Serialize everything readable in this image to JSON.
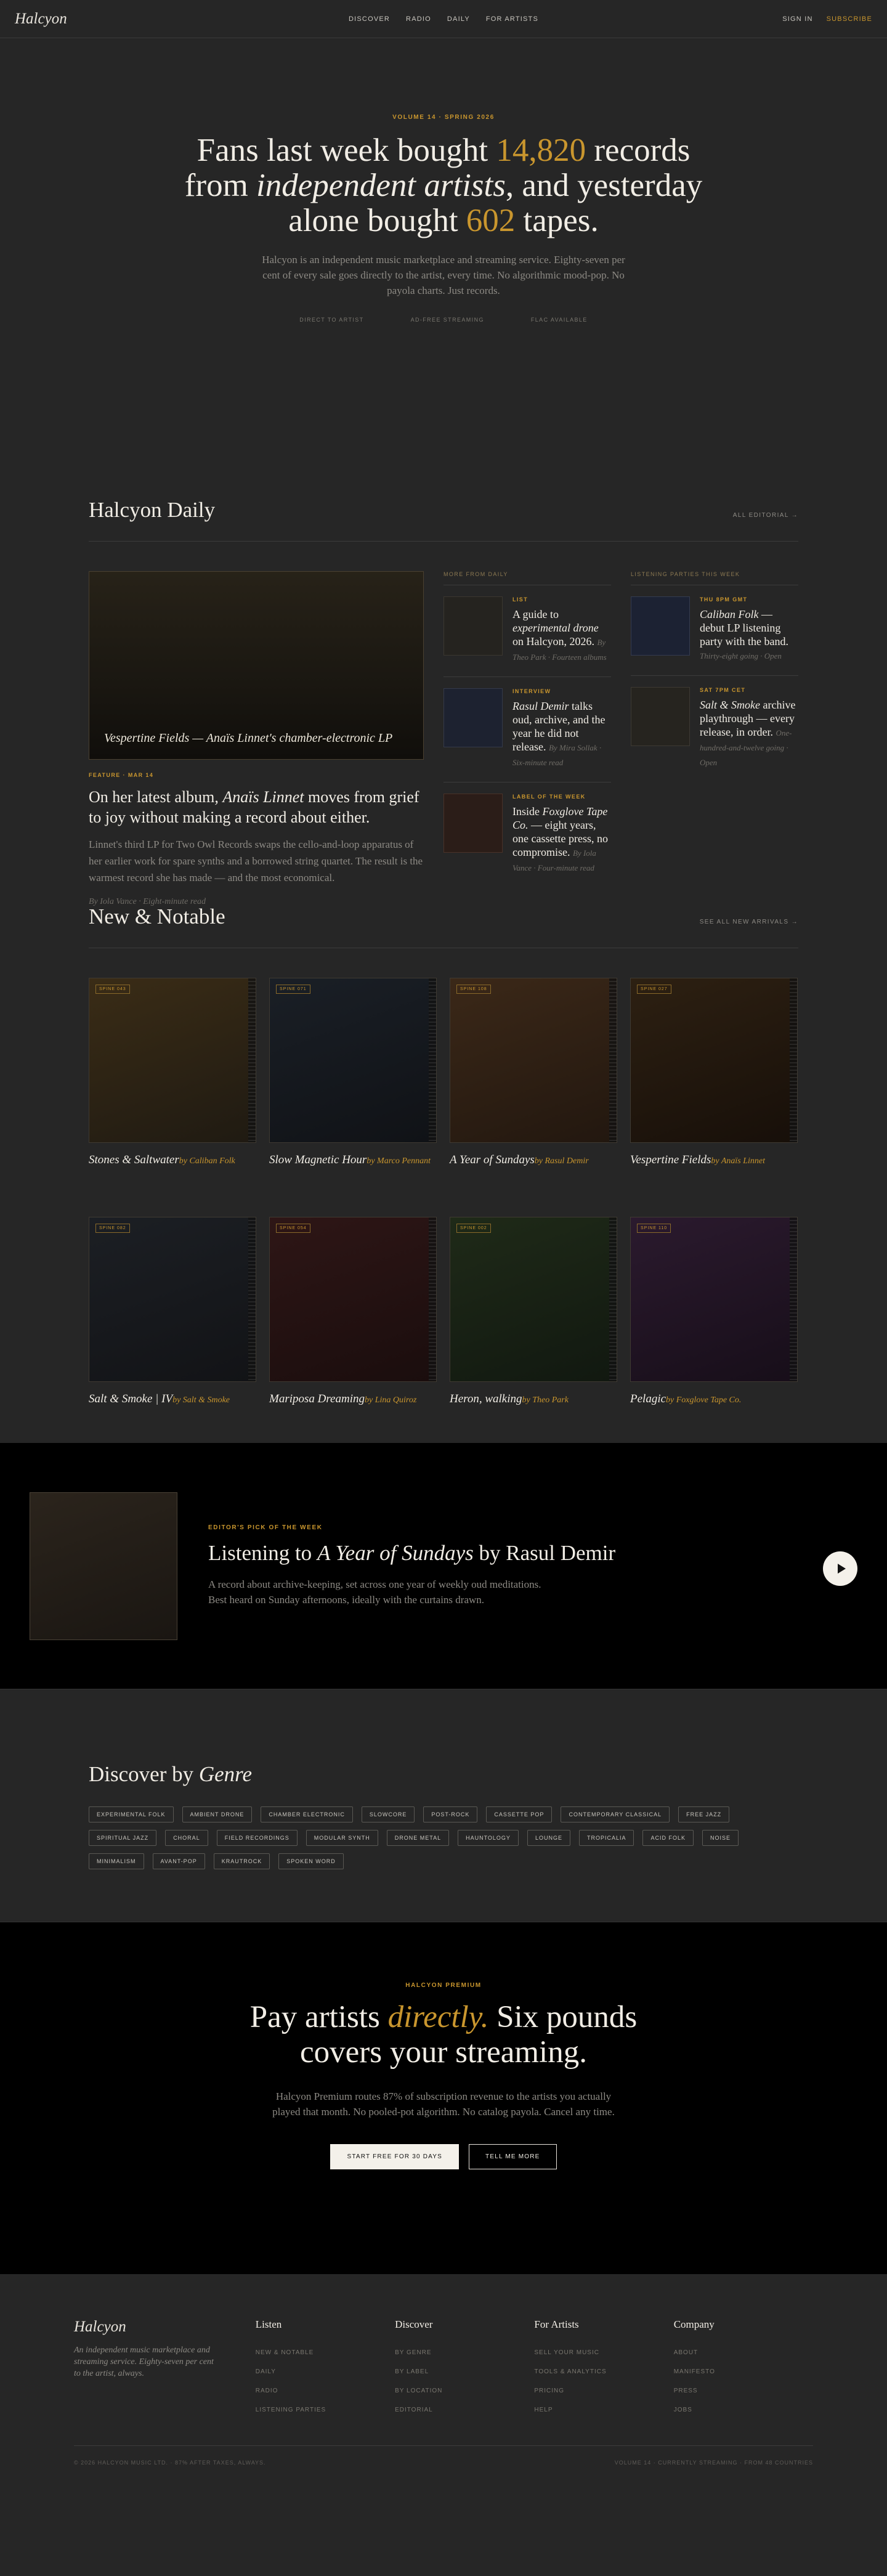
{
  "nav": {
    "logo": "Halcyon",
    "links": [
      "DISCOVER",
      "RADIO",
      "DAILY",
      "FOR ARTISTS"
    ],
    "sign_in": "SIGN IN",
    "subscribe": "SUBSCRIBE"
  },
  "hero": {
    "eyebrow": "VOLUME 14 · SPRING 2026",
    "line1a": "Fans last week bought ",
    "records_count": "14,820",
    "line1b": " records",
    "line2a": "from ",
    "line2em": "independent artists",
    "line2b": ", and yesterday",
    "line3a": "alone bought ",
    "tapes_count": "602",
    "line3b": " tapes.",
    "lead": "Halcyon is an independent music marketplace and streaming service. Eighty-seven per cent of every sale goes directly to the artist, every time. No algorithmic mood-pop. No payola charts. Just records.",
    "meta": [
      "DIRECT TO ARTIST",
      "AD-FREE STREAMING",
      "FLAC AVAILABLE"
    ]
  },
  "daily": {
    "title": "Halcyon Daily",
    "link": "ALL EDITORIAL →",
    "feature": {
      "caption": "Vespertine Fields — Anaïs Linnet's chamber-electronic LP",
      "kicker": "FEATURE · MAR 14",
      "h_a": "On her latest album, ",
      "h_em": "Anaïs Linnet",
      "h_b": " moves from grief to joy without making a record about either.",
      "body": "Linnet's third LP for Two Owl Records swaps the cello-and-loop apparatus of her earlier work for spare synths and a borrowed string quartet. The result is the warmest record she has made — and the most economical.",
      "byline": "By Iola Vance · Eight-minute read"
    },
    "more_head": "MORE FROM DAILY",
    "more": [
      {
        "kicker": "LIST",
        "a": "A guide to ",
        "em": "experimental drone",
        "b": " on Halcyon, 2026.",
        "meta": "By Theo Park · Fourteen albums"
      },
      {
        "kicker": "INTERVIEW",
        "a": "",
        "em": "Rasul Demir",
        "b": " talks oud, archive, and the year he did not release.",
        "meta": "By Mira Sollak · Six-minute read"
      },
      {
        "kicker": "LABEL OF THE WEEK",
        "a": "Inside ",
        "em": "Foxglove Tape Co.",
        "b": " — eight years, one cassette press, no compromise.",
        "meta": "By Iola Vance · Four-minute read"
      }
    ],
    "parties_head": "LISTENING PARTIES THIS WEEK",
    "parties": [
      {
        "kicker": "THU 8PM GMT",
        "em": "Caliban Folk",
        "b": " — debut LP listening party with the band.",
        "meta": "Thirty-eight going · Open"
      },
      {
        "kicker": "SAT 7PM CET",
        "em": "Salt & Smoke",
        "b": " archive playthrough — every release, in order.",
        "meta": "One-hundred-and-twelve going · Open"
      }
    ]
  },
  "notable": {
    "title": "New & Notable",
    "link": "SEE ALL NEW ARRIVALS →",
    "records": [
      {
        "tag": "SPINE 043",
        "title": "Stones & Saltwater",
        "artist": "by Caliban Folk"
      },
      {
        "tag": "SPINE 071",
        "title": "Slow Magnetic Hour",
        "artist": "by Marco Pennant"
      },
      {
        "tag": "SPINE 108",
        "title": "A Year of Sundays",
        "artist": "by Rasul Demir"
      },
      {
        "tag": "SPINE 027",
        "title": "Vespertine Fields",
        "artist": "by Anaïs Linnet"
      },
      {
        "tag": "SPINE 082",
        "title": "Salt & Smoke | IV",
        "artist": "by Salt & Smoke"
      },
      {
        "tag": "SPINE 054",
        "title": "Mariposa Dreaming",
        "artist": "by Lina Quiroz"
      },
      {
        "tag": "SPINE 002",
        "title": "Heron, walking",
        "artist": "by Theo Park"
      },
      {
        "tag": "SPINE 110",
        "title": "Pelagic",
        "artist": "by Foxglove Tape Co."
      }
    ]
  },
  "pick": {
    "eyebrow": "EDITOR'S PICK OF THE WEEK",
    "h_a": "Listening to ",
    "h_em": "A Year of Sundays",
    "h_b": " by Rasul Demir",
    "body": "A record about archive-keeping, set across one year of weekly oud meditations. Best heard on Sunday afternoons, ideally with the curtains drawn."
  },
  "genre": {
    "title_a": "Discover by ",
    "title_em": "Genre",
    "chips": [
      "EXPERIMENTAL FOLK",
      "AMBIENT DRONE",
      "CHAMBER ELECTRONIC",
      "SLOWCORE",
      "POST-ROCK",
      "CASSETTE POP",
      "CONTEMPORARY CLASSICAL",
      "FREE JAZZ",
      "SPIRITUAL JAZZ",
      "CHORAL",
      "FIELD RECORDINGS",
      "MODULAR SYNTH",
      "DRONE METAL",
      "HAUNTOLOGY",
      "LOUNGE",
      "TROPICALIA",
      "ACID FOLK",
      "NOISE",
      "MINIMALISM",
      "AVANT-POP",
      "KRAUTROCK",
      "SPOKEN WORD"
    ]
  },
  "premium": {
    "eyebrow": "HALCYON PREMIUM",
    "h_a": "Pay artists ",
    "h_em": "directly.",
    "h_b": " Six pounds covers your streaming.",
    "body": "Halcyon Premium routes 87% of subscription revenue to the artists you actually played that month. No pooled-pot algorithm. No catalog payola. Cancel any time.",
    "primary": "START FREE FOR 30 DAYS",
    "secondary": "TELL ME MORE"
  },
  "footer": {
    "logo": "Halcyon",
    "tagline": "An independent music marketplace and streaming service. Eighty-seven per cent to the artist, always.",
    "cols": [
      {
        "title": "Listen",
        "links": [
          "NEW & NOTABLE",
          "DAILY",
          "RADIO",
          "LISTENING PARTIES"
        ]
      },
      {
        "title": "Discover",
        "links": [
          "BY GENRE",
          "BY LABEL",
          "BY LOCATION",
          "EDITORIAL"
        ]
      },
      {
        "title": "For Artists",
        "links": [
          "SELL YOUR MUSIC",
          "TOOLS & ANALYTICS",
          "PRICING",
          "HELP"
        ]
      },
      {
        "title": "Company",
        "links": [
          "ABOUT",
          "MANIFESTO",
          "PRESS",
          "JOBS"
        ]
      }
    ],
    "copyright": "© 2026 HALCYON MUSIC LTD. · 87% AFTER TAXES, ALWAYS.",
    "volume": "VOLUME 14 · CURRENTLY STREAMING · FROM 48 COUNTRIES"
  },
  "colors": {
    "accent": "#c9962e",
    "background": "#262626",
    "black_band": "#000000"
  }
}
